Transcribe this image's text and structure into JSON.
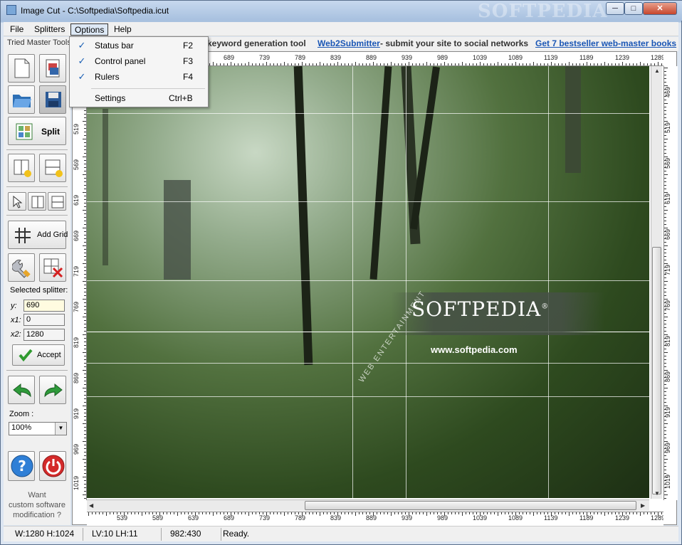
{
  "window": {
    "title": "Image Cut - C:\\Softpedia\\Softpedia.icut",
    "watermark": "SOFTPEDIA",
    "min_glyph": "─",
    "max_glyph": "□",
    "close_glyph": "✕"
  },
  "menu": {
    "file": "File",
    "splitters": "Splitters",
    "options": "Options",
    "help": "Help"
  },
  "linkbar": {
    "left_text": "keyword generation tool",
    "web2submitter": "Web2Submitter",
    "web2_desc": " - submit your site to social networks",
    "bestseller": "Get 7 bestseller web-master books"
  },
  "options_menu": [
    {
      "label": "Status bar",
      "shortcut": "F2",
      "checked": "✓"
    },
    {
      "label": "Control panel",
      "shortcut": "F3",
      "checked": "✓"
    },
    {
      "label": "Rulers",
      "shortcut": "F4",
      "checked": "✓"
    },
    {
      "label": "Settings",
      "shortcut": "Ctrl+B",
      "checked": ""
    }
  ],
  "left_panel": {
    "title": "Tried Master Tools",
    "split_label": "Split",
    "add_grid_label": "Add Grid",
    "selected_splitter": "Selected splitter:",
    "y_label": "y:",
    "y_value": "690",
    "x1_label": "x1:",
    "x1_value": "0",
    "x2_label": "x2:",
    "x2_value": "1280",
    "accept_label": "Accept",
    "zoom_label": "Zoom :",
    "zoom_value": "100%",
    "want_text_1": "Want",
    "want_text_2": "custom software",
    "want_text_3": "modification ?"
  },
  "image": {
    "logo": "SOFTPEDIA",
    "reg": "®",
    "url": "www.softpedia.com",
    "sub": "WEB ENTERTAINMENT"
  },
  "rulers": {
    "top": [
      "689",
      "739",
      "789",
      "839",
      "889",
      "939",
      "989",
      "1039",
      "1089",
      "1139",
      "1189",
      "1239",
      "1289"
    ],
    "bottom": [
      "539",
      "589",
      "639",
      "689",
      "739",
      "789",
      "839",
      "889",
      "939",
      "989",
      "1039",
      "1089",
      "1139",
      "1189",
      "1239",
      "1289"
    ],
    "left": [
      "519",
      "569",
      "619",
      "669",
      "719",
      "769",
      "819",
      "869",
      "919",
      "969",
      "1019"
    ],
    "right": [
      "469",
      "519",
      "569",
      "619",
      "669",
      "719",
      "769",
      "819",
      "869",
      "919",
      "969",
      "1019"
    ]
  },
  "status": {
    "size": "W:1280 H:1024",
    "lines": "LV:10 LH:11",
    "coords": "982:430",
    "state": "Ready."
  },
  "colors": {
    "accent": "#1a56b5",
    "menu_highlight": "#dde8f5"
  }
}
